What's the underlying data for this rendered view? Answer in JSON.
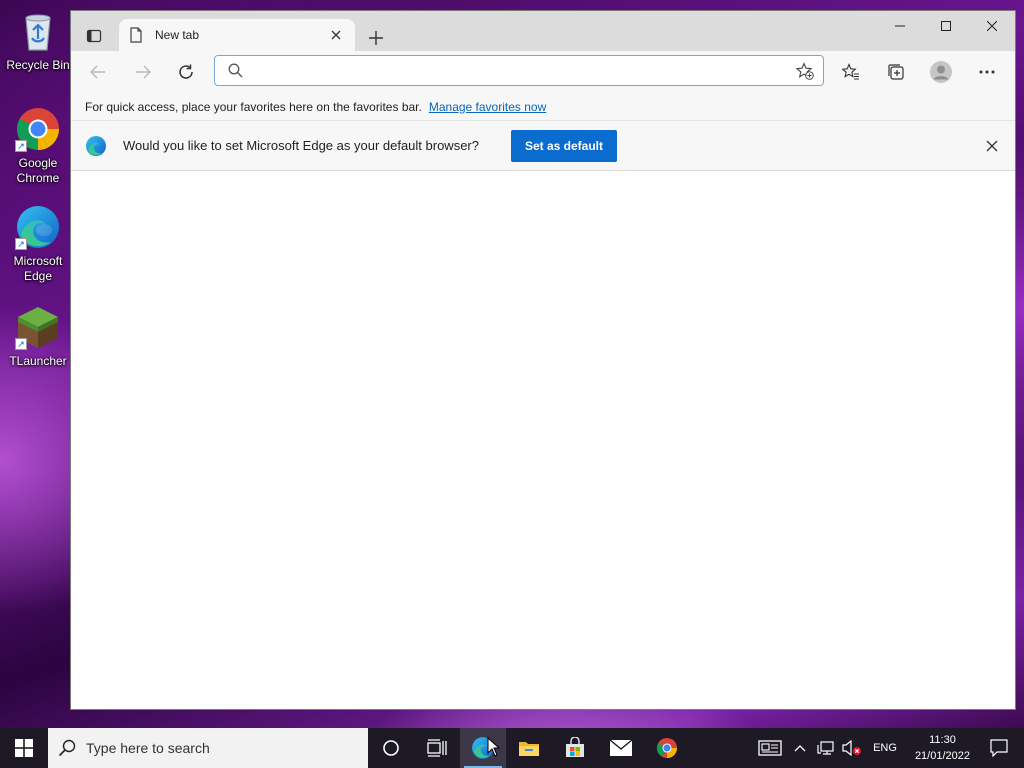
{
  "desktop": {
    "icons": [
      {
        "label": "Recycle Bin"
      },
      {
        "label": "Google Chrome"
      },
      {
        "label": "Microsoft Edge"
      },
      {
        "label": "TLauncher"
      }
    ]
  },
  "browser": {
    "tab": {
      "title": "New tab"
    },
    "address_bar": {
      "value": "",
      "placeholder": ""
    },
    "favorites_bar": {
      "text": "For quick access, place your favorites here on the favorites bar.",
      "link": "Manage favorites now"
    },
    "infobar": {
      "message": "Would you like to set Microsoft Edge as your default browser?",
      "button": "Set as default"
    }
  },
  "taskbar": {
    "search_placeholder": "Type here to search",
    "language": "ENG",
    "time": "11:30",
    "date": "21/01/2022"
  },
  "colors": {
    "accent": "#0a6cce",
    "link": "#0b64b8",
    "taskbar": "#1d1a26"
  }
}
